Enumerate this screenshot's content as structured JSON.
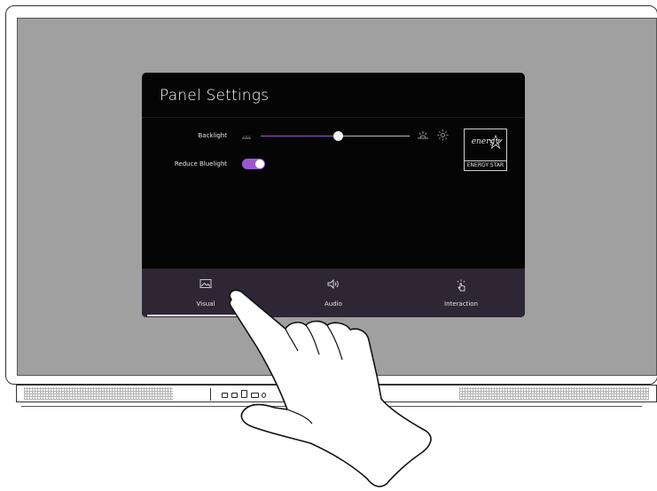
{
  "panel": {
    "title": "Panel Settings",
    "backlight": {
      "label": "Backlight",
      "value_fraction": 0.52,
      "min_icon": "sun-dim-icon",
      "max_icon": "sun-bright-icon"
    },
    "reduce_bluelight": {
      "label": "Reduce Bluelight",
      "enabled": true
    },
    "badge": {
      "script": "energy",
      "bar": "ENERGY STAR"
    },
    "tabs": [
      {
        "label": "Visual",
        "icon": "image-icon",
        "selected": true
      },
      {
        "label": "Audio",
        "icon": "speaker-icon",
        "selected": false
      },
      {
        "label": "Interaction",
        "icon": "tap-icon",
        "selected": false
      }
    ]
  },
  "colors": {
    "accent": "#9b59d0",
    "panel_bg": "#050505",
    "tabbar_bg": "#2e2634",
    "screen_bg": "#a0a0a0"
  },
  "overlay": {
    "icon": "pointing-hand-icon"
  }
}
